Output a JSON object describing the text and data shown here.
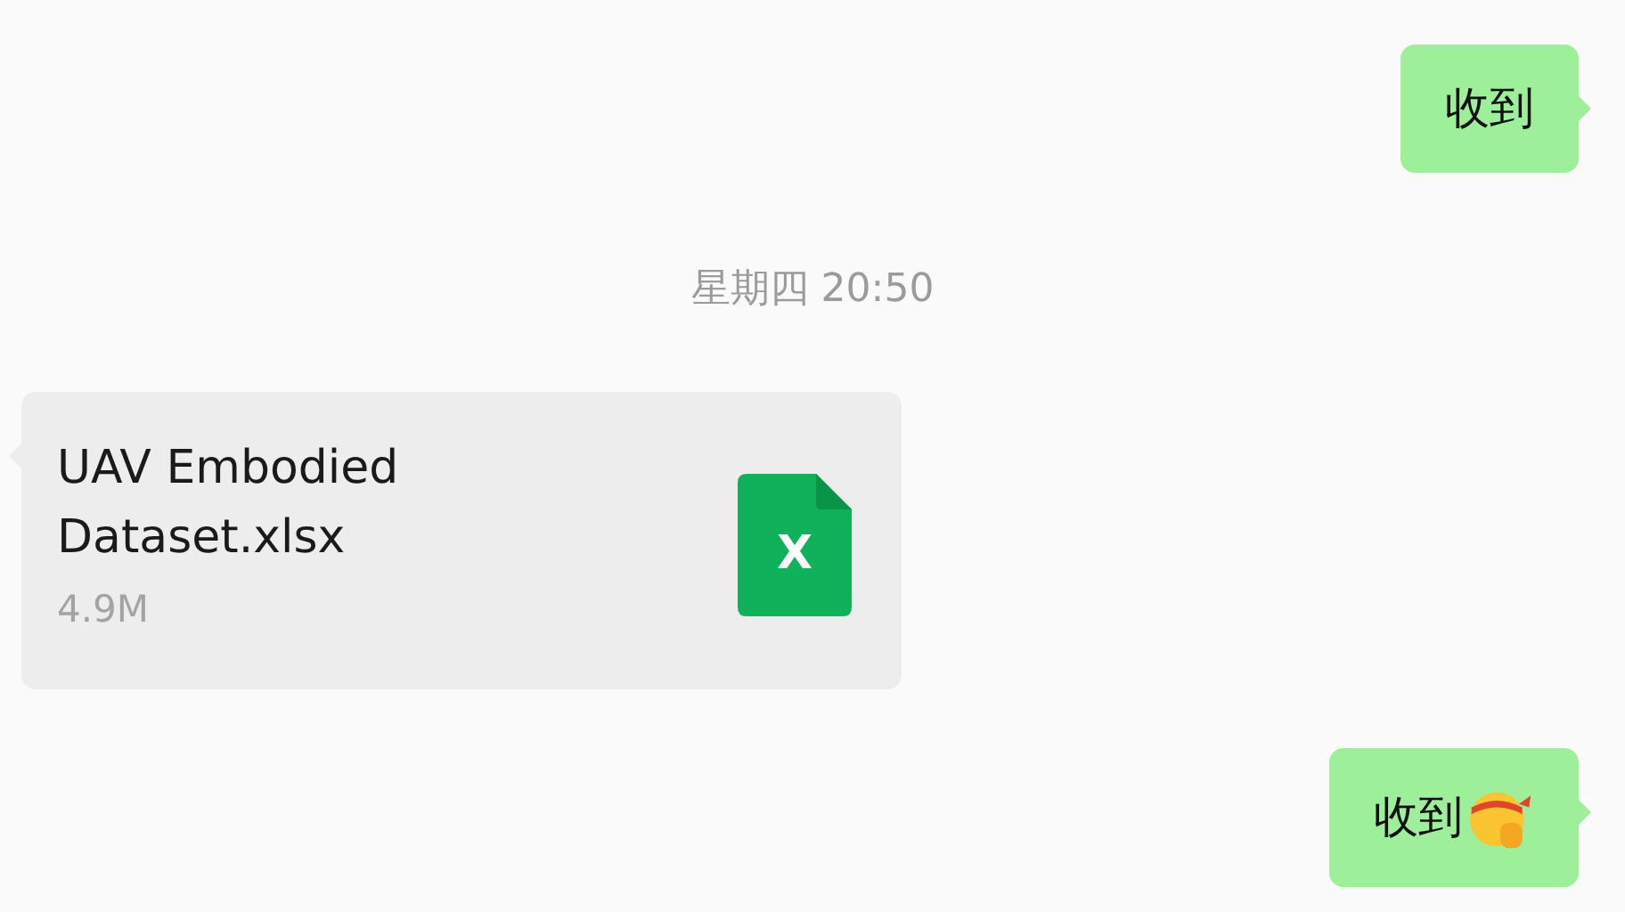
{
  "messages": [
    {
      "kind": "outgoing_text",
      "text": "收到",
      "emoji": false
    },
    {
      "kind": "timestamp",
      "text": "星期四 20:50"
    },
    {
      "kind": "incoming_file",
      "file_name": "UAV Embodied Dataset.xlsx",
      "file_size": "4.9M",
      "icon_label": "X"
    },
    {
      "kind": "outgoing_text",
      "text": "收到",
      "emoji": true
    }
  ]
}
